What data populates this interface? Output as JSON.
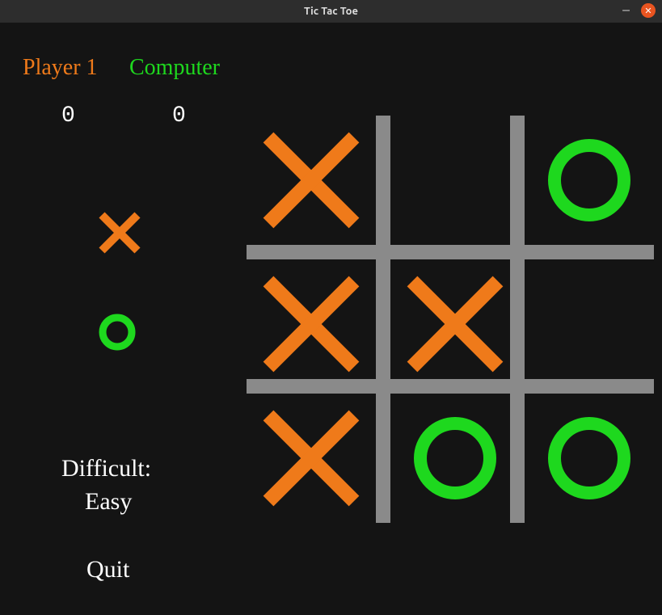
{
  "window": {
    "title": "Tic Tac Toe"
  },
  "labels": {
    "player": "Player 1",
    "computer": "Computer",
    "difficult": "Difficult:",
    "quit": "Quit"
  },
  "scores": {
    "player": "0",
    "computer": "0"
  },
  "difficulty": "Easy",
  "legend": {
    "player_mark": "X",
    "computer_mark": "O"
  },
  "colors": {
    "player": "#ef7a1a",
    "computer": "#1ed81e",
    "grid": "#8a8a8a",
    "bg": "#141414"
  },
  "board": [
    [
      "X",
      "",
      "O"
    ],
    [
      "X",
      "X",
      ""
    ],
    [
      "X",
      "O",
      "O"
    ]
  ]
}
